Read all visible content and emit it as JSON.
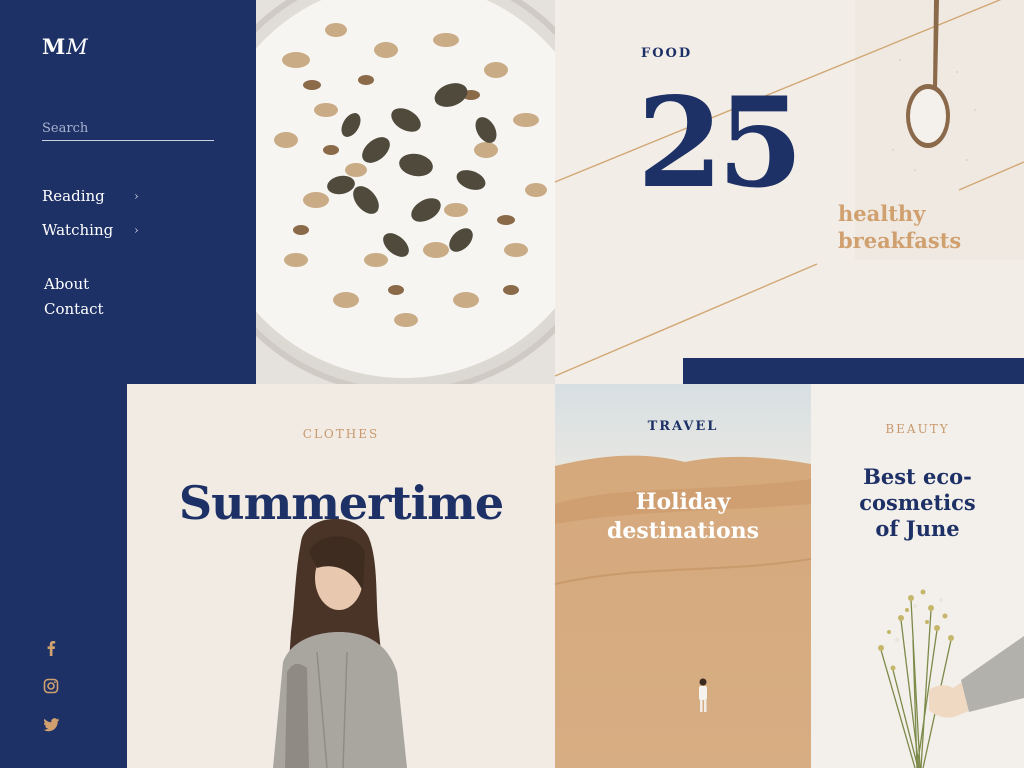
{
  "brand": {
    "logo_bold": "M",
    "logo_italic": "M"
  },
  "search": {
    "placeholder": "Search"
  },
  "nav": {
    "items": [
      {
        "label": "Reading",
        "has_submenu": true
      },
      {
        "label": "Watching",
        "has_submenu": true
      },
      {
        "label": "About"
      },
      {
        "label": "Contact"
      }
    ]
  },
  "social": [
    "facebook-icon",
    "instagram-icon",
    "twitter-icon"
  ],
  "cards": {
    "food": {
      "tag": "FOOD",
      "number": "25",
      "subtitle_line1": "healthy",
      "subtitle_line2": "breakfasts"
    },
    "clothes": {
      "tag": "CLOTHES",
      "title": "Summertime"
    },
    "travel": {
      "tag": "TRAVEL",
      "title_line1": "Holiday",
      "title_line2": "destinations"
    },
    "beauty": {
      "tag": "BEAUTY",
      "title_line1": "Best eco-",
      "title_line2": "cosmetics",
      "title_line3": "of June"
    }
  },
  "colors": {
    "navy": "#1d3166",
    "gold": "#d0a06f",
    "cream": "#f1ece6"
  }
}
